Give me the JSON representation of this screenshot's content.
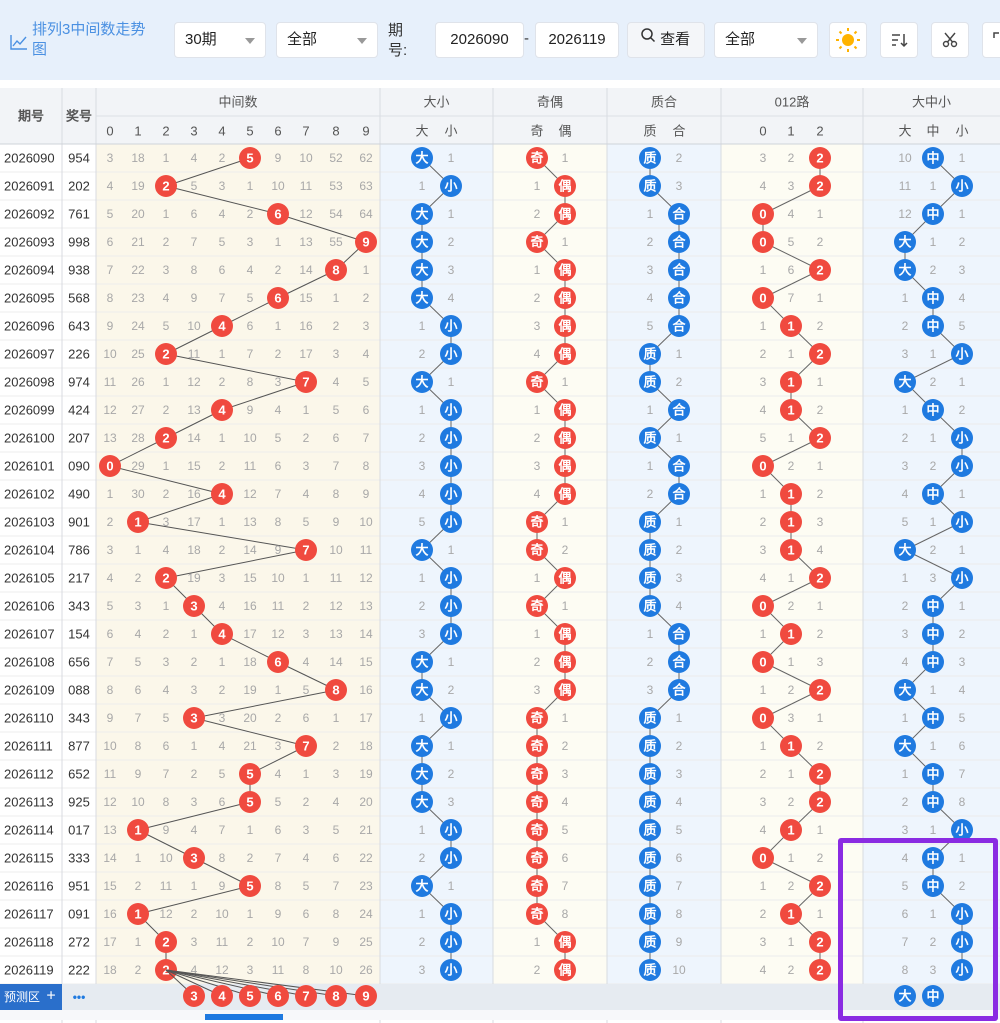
{
  "toolbar": {
    "title": "排列3中间数走势图",
    "period_count": "30期",
    "filter_1": "全部",
    "issue_label": "期号:",
    "issue_from": "2026090",
    "issue_dash": "-",
    "issue_to": "2026119",
    "query_label": "查看",
    "filter_2": "全部",
    "icons": [
      "chart-line-icon",
      "sun-icon",
      "sort-icon",
      "scissors-icon",
      "expand-icon"
    ]
  },
  "colors": {
    "red": "#f04a3f",
    "blue": "#1f7ae0",
    "purple": "#8a2be2"
  },
  "headers": {
    "issue": "期号",
    "prize": "奖号",
    "groups": [
      {
        "label": "中间数",
        "cols": [
          "0",
          "1",
          "2",
          "3",
          "4",
          "5",
          "6",
          "7",
          "8",
          "9"
        ]
      },
      {
        "label": "大小",
        "cols": [
          "大",
          "小"
        ]
      },
      {
        "label": "奇偶",
        "cols": [
          "奇",
          "偶"
        ]
      },
      {
        "label": "质合",
        "cols": [
          "质",
          "合"
        ]
      },
      {
        "label": "012路",
        "cols": [
          "0",
          "1",
          "2"
        ]
      },
      {
        "label": "大中小",
        "cols": [
          "大",
          "中",
          "小"
        ]
      }
    ]
  },
  "rows": [
    {
      "issue": "2026090",
      "prize": "954",
      "mid": [
        3,
        18,
        1,
        4,
        2,
        "5",
        9,
        10,
        52,
        62
      ],
      "bs": [
        "大",
        1
      ],
      "oe": [
        "奇",
        1
      ],
      "pc": [
        "质",
        2
      ],
      "r012": [
        3,
        2,
        "2"
      ],
      "bms": [
        10,
        "中",
        1
      ]
    },
    {
      "issue": "2026091",
      "prize": "202",
      "mid": [
        4,
        19,
        "2",
        5,
        3,
        1,
        10,
        11,
        53,
        63
      ],
      "bs": [
        1,
        "小"
      ],
      "oe": [
        1,
        "偶"
      ],
      "pc": [
        "质",
        3
      ],
      "r012": [
        4,
        3,
        "2"
      ],
      "bms": [
        11,
        1,
        "小"
      ]
    },
    {
      "issue": "2026092",
      "prize": "761",
      "mid": [
        5,
        20,
        1,
        6,
        4,
        2,
        "6",
        12,
        54,
        64
      ],
      "bs": [
        "大",
        1
      ],
      "oe": [
        2,
        "偶"
      ],
      "pc": [
        1,
        "合"
      ],
      "r012": [
        "0",
        4,
        1
      ],
      "bms": [
        12,
        "中",
        1
      ]
    },
    {
      "issue": "2026093",
      "prize": "998",
      "mid": [
        6,
        21,
        2,
        7,
        5,
        3,
        1,
        13,
        55,
        "9"
      ],
      "bs": [
        "大",
        2
      ],
      "oe": [
        "奇",
        1
      ],
      "pc": [
        2,
        "合"
      ],
      "r012": [
        "0",
        5,
        2
      ],
      "bms": [
        "大",
        1,
        2
      ]
    },
    {
      "issue": "2026094",
      "prize": "938",
      "mid": [
        7,
        22,
        3,
        8,
        6,
        4,
        2,
        14,
        "8",
        1
      ],
      "bs": [
        "大",
        3
      ],
      "oe": [
        1,
        "偶"
      ],
      "pc": [
        3,
        "合"
      ],
      "r012": [
        1,
        6,
        "2"
      ],
      "bms": [
        "大",
        2,
        3
      ]
    },
    {
      "issue": "2026095",
      "prize": "568",
      "mid": [
        8,
        23,
        4,
        9,
        7,
        5,
        "6",
        15,
        1,
        2
      ],
      "bs": [
        "大",
        4
      ],
      "oe": [
        2,
        "偶"
      ],
      "pc": [
        4,
        "合"
      ],
      "r012": [
        "0",
        7,
        1
      ],
      "bms": [
        1,
        "中",
        4
      ]
    },
    {
      "issue": "2026096",
      "prize": "643",
      "mid": [
        9,
        24,
        5,
        10,
        "4",
        6,
        1,
        16,
        2,
        3
      ],
      "bs": [
        1,
        "小"
      ],
      "oe": [
        3,
        "偶"
      ],
      "pc": [
        5,
        "合"
      ],
      "r012": [
        1,
        "1",
        2
      ],
      "bms": [
        2,
        "中",
        5
      ]
    },
    {
      "issue": "2026097",
      "prize": "226",
      "mid": [
        10,
        25,
        "2",
        11,
        1,
        7,
        2,
        17,
        3,
        4
      ],
      "bs": [
        2,
        "小"
      ],
      "oe": [
        4,
        "偶"
      ],
      "pc": [
        "质",
        1
      ],
      "r012": [
        2,
        1,
        "2"
      ],
      "bms": [
        3,
        1,
        "小"
      ]
    },
    {
      "issue": "2026098",
      "prize": "974",
      "mid": [
        11,
        26,
        1,
        12,
        2,
        8,
        3,
        "7",
        4,
        5
      ],
      "bs": [
        "大",
        1
      ],
      "oe": [
        "奇",
        1
      ],
      "pc": [
        "质",
        2
      ],
      "r012": [
        3,
        "1",
        1
      ],
      "bms": [
        "大",
        2,
        1
      ]
    },
    {
      "issue": "2026099",
      "prize": "424",
      "mid": [
        12,
        27,
        2,
        13,
        "4",
        9,
        4,
        1,
        5,
        6
      ],
      "bs": [
        1,
        "小"
      ],
      "oe": [
        1,
        "偶"
      ],
      "pc": [
        1,
        "合"
      ],
      "r012": [
        4,
        "1",
        2
      ],
      "bms": [
        1,
        "中",
        2
      ]
    },
    {
      "issue": "2026100",
      "prize": "207",
      "mid": [
        13,
        28,
        "2",
        14,
        1,
        10,
        5,
        2,
        6,
        7
      ],
      "bs": [
        2,
        "小"
      ],
      "oe": [
        2,
        "偶"
      ],
      "pc": [
        "质",
        1
      ],
      "r012": [
        5,
        1,
        "2"
      ],
      "bms": [
        2,
        1,
        "小"
      ]
    },
    {
      "issue": "2026101",
      "prize": "090",
      "mid": [
        "0",
        29,
        1,
        15,
        2,
        11,
        6,
        3,
        7,
        8
      ],
      "bs": [
        3,
        "小"
      ],
      "oe": [
        3,
        "偶"
      ],
      "pc": [
        1,
        "合"
      ],
      "r012": [
        "0",
        2,
        1
      ],
      "bms": [
        3,
        2,
        "小"
      ]
    },
    {
      "issue": "2026102",
      "prize": "490",
      "mid": [
        1,
        30,
        2,
        16,
        "4",
        12,
        7,
        4,
        8,
        9
      ],
      "bs": [
        4,
        "小"
      ],
      "oe": [
        4,
        "偶"
      ],
      "pc": [
        2,
        "合"
      ],
      "r012": [
        1,
        "1",
        2
      ],
      "bms": [
        4,
        "中",
        1
      ]
    },
    {
      "issue": "2026103",
      "prize": "901",
      "mid": [
        2,
        "1",
        3,
        17,
        1,
        13,
        8,
        5,
        9,
        10
      ],
      "bs": [
        5,
        "小"
      ],
      "oe": [
        "奇",
        1
      ],
      "pc": [
        "质",
        1
      ],
      "r012": [
        2,
        "1",
        3
      ],
      "bms": [
        5,
        1,
        "小"
      ]
    },
    {
      "issue": "2026104",
      "prize": "786",
      "mid": [
        3,
        1,
        4,
        18,
        2,
        14,
        9,
        "7",
        10,
        11
      ],
      "bs": [
        "大",
        1
      ],
      "oe": [
        "奇",
        2
      ],
      "pc": [
        "质",
        2
      ],
      "r012": [
        3,
        "1",
        4
      ],
      "bms": [
        "大",
        2,
        1
      ]
    },
    {
      "issue": "2026105",
      "prize": "217",
      "mid": [
        4,
        2,
        "2",
        19,
        3,
        15,
        10,
        1,
        11,
        12
      ],
      "bs": [
        1,
        "小"
      ],
      "oe": [
        1,
        "偶"
      ],
      "pc": [
        "质",
        3
      ],
      "r012": [
        4,
        1,
        "2"
      ],
      "bms": [
        1,
        3,
        "小"
      ]
    },
    {
      "issue": "2026106",
      "prize": "343",
      "mid": [
        5,
        3,
        1,
        "3",
        4,
        16,
        11,
        2,
        12,
        13
      ],
      "bs": [
        2,
        "小"
      ],
      "oe": [
        "奇",
        1
      ],
      "pc": [
        "质",
        4
      ],
      "r012": [
        "0",
        2,
        1
      ],
      "bms": [
        2,
        "中",
        1
      ]
    },
    {
      "issue": "2026107",
      "prize": "154",
      "mid": [
        6,
        4,
        2,
        1,
        "4",
        17,
        12,
        3,
        13,
        14
      ],
      "bs": [
        3,
        "小"
      ],
      "oe": [
        1,
        "偶"
      ],
      "pc": [
        1,
        "合"
      ],
      "r012": [
        1,
        "1",
        2
      ],
      "bms": [
        3,
        "中",
        2
      ]
    },
    {
      "issue": "2026108",
      "prize": "656",
      "mid": [
        7,
        5,
        3,
        2,
        1,
        18,
        "6",
        4,
        14,
        15
      ],
      "bs": [
        "大",
        1
      ],
      "oe": [
        2,
        "偶"
      ],
      "pc": [
        2,
        "合"
      ],
      "r012": [
        "0",
        1,
        3
      ],
      "bms": [
        4,
        "中",
        3
      ]
    },
    {
      "issue": "2026109",
      "prize": "088",
      "mid": [
        8,
        6,
        4,
        3,
        2,
        19,
        1,
        5,
        "8",
        16
      ],
      "bs": [
        "大",
        2
      ],
      "oe": [
        3,
        "偶"
      ],
      "pc": [
        3,
        "合"
      ],
      "r012": [
        1,
        2,
        "2"
      ],
      "bms": [
        "大",
        1,
        4
      ]
    },
    {
      "issue": "2026110",
      "prize": "343",
      "mid": [
        9,
        7,
        5,
        "3",
        3,
        20,
        2,
        6,
        1,
        17
      ],
      "bs": [
        1,
        "小"
      ],
      "oe": [
        "奇",
        1
      ],
      "pc": [
        "质",
        1
      ],
      "r012": [
        "0",
        3,
        1
      ],
      "bms": [
        1,
        "中",
        5
      ]
    },
    {
      "issue": "2026111",
      "prize": "877",
      "mid": [
        10,
        8,
        6,
        1,
        4,
        21,
        3,
        "7",
        2,
        18
      ],
      "bs": [
        "大",
        1
      ],
      "oe": [
        "奇",
        2
      ],
      "pc": [
        "质",
        2
      ],
      "r012": [
        1,
        "1",
        2
      ],
      "bms": [
        "大",
        1,
        6
      ]
    },
    {
      "issue": "2026112",
      "prize": "652",
      "mid": [
        11,
        9,
        7,
        2,
        5,
        "5",
        4,
        1,
        3,
        19
      ],
      "bs": [
        "大",
        2
      ],
      "oe": [
        "奇",
        3
      ],
      "pc": [
        "质",
        3
      ],
      "r012": [
        2,
        1,
        "2"
      ],
      "bms": [
        1,
        "中",
        7
      ]
    },
    {
      "issue": "2026113",
      "prize": "925",
      "mid": [
        12,
        10,
        8,
        3,
        6,
        "5",
        5,
        2,
        4,
        20
      ],
      "bs": [
        "大",
        3
      ],
      "oe": [
        "奇",
        4
      ],
      "pc": [
        "质",
        4
      ],
      "r012": [
        3,
        2,
        "2"
      ],
      "bms": [
        2,
        "中",
        8
      ]
    },
    {
      "issue": "2026114",
      "prize": "017",
      "mid": [
        13,
        "1",
        9,
        4,
        7,
        1,
        6,
        3,
        5,
        21
      ],
      "bs": [
        1,
        "小"
      ],
      "oe": [
        "奇",
        5
      ],
      "pc": [
        "质",
        5
      ],
      "r012": [
        4,
        "1",
        1
      ],
      "bms": [
        3,
        1,
        "小"
      ]
    },
    {
      "issue": "2026115",
      "prize": "333",
      "mid": [
        14,
        1,
        10,
        "3",
        8,
        2,
        7,
        4,
        6,
        22
      ],
      "bs": [
        2,
        "小"
      ],
      "oe": [
        "奇",
        6
      ],
      "pc": [
        "质",
        6
      ],
      "r012": [
        "0",
        1,
        2
      ],
      "bms": [
        4,
        "中",
        1
      ]
    },
    {
      "issue": "2026116",
      "prize": "951",
      "mid": [
        15,
        2,
        11,
        1,
        9,
        "5",
        8,
        5,
        7,
        23
      ],
      "bs": [
        "大",
        1
      ],
      "oe": [
        "奇",
        7
      ],
      "pc": [
        "质",
        7
      ],
      "r012": [
        1,
        2,
        "2"
      ],
      "bms": [
        5,
        "中",
        2
      ]
    },
    {
      "issue": "2026117",
      "prize": "091",
      "mid": [
        16,
        "1",
        12,
        2,
        10,
        1,
        9,
        6,
        8,
        24
      ],
      "bs": [
        1,
        "小"
      ],
      "oe": [
        "奇",
        8
      ],
      "pc": [
        "质",
        8
      ],
      "r012": [
        2,
        "1",
        1
      ],
      "bms": [
        6,
        1,
        "小"
      ]
    },
    {
      "issue": "2026118",
      "prize": "272",
      "mid": [
        17,
        1,
        "2",
        3,
        11,
        2,
        10,
        7,
        9,
        25
      ],
      "bs": [
        2,
        "小"
      ],
      "oe": [
        1,
        "偶"
      ],
      "pc": [
        "质",
        9
      ],
      "r012": [
        3,
        1,
        "2"
      ],
      "bms": [
        7,
        2,
        "小"
      ]
    },
    {
      "issue": "2026119",
      "prize": "222",
      "mid": [
        18,
        2,
        "2",
        4,
        12,
        3,
        11,
        8,
        10,
        26
      ],
      "bs": [
        3,
        "小"
      ],
      "oe": [
        2,
        "偶"
      ],
      "pc": [
        "质",
        10
      ],
      "r012": [
        4,
        2,
        "2"
      ],
      "bms": [
        8,
        3,
        "小"
      ]
    }
  ],
  "predict": {
    "label": "预测区",
    "plus": "+",
    "more": "•••",
    "mid_balls": [
      "3",
      "4",
      "5",
      "6",
      "7",
      "8",
      "9"
    ],
    "bms_balls": [
      "大",
      "中"
    ]
  }
}
